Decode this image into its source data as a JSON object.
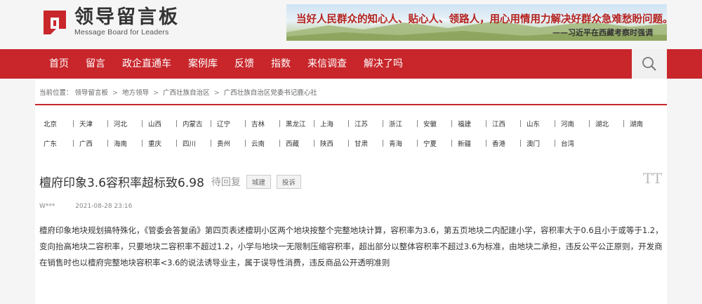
{
  "header": {
    "logo_cn": "领导留言板",
    "logo_en": "Message Board for Leaders",
    "banner_quote": "当好人民群众的知心人、贴心人、领路人，用心用情用力解决好群众急难愁盼问题。",
    "banner_author": "——习近平在西藏考察时强调"
  },
  "nav": {
    "items": [
      "首页",
      "留言",
      "政企直通车",
      "案例库",
      "反馈",
      "指数",
      "来信调查",
      "解决了吗"
    ],
    "search_icon": "search-icon"
  },
  "breadcrumb": {
    "prefix": "当前位置：",
    "items": [
      "领导留言板",
      "地方领导",
      "广西壮族自治区",
      "广西壮族自治区党委书记鹿心社"
    ],
    "separator": ">"
  },
  "regions": {
    "row1": [
      "北京",
      "天津",
      "河北",
      "山西",
      "内蒙古",
      "辽宁",
      "吉林",
      "黑龙江",
      "上海",
      "江苏",
      "浙江",
      "安徽",
      "福建",
      "江西",
      "山东",
      "河南",
      "湖北",
      "湖南"
    ],
    "row2": [
      "广东",
      "广西",
      "海南",
      "重庆",
      "四川",
      "贵州",
      "云南",
      "西藏",
      "陕西",
      "甘肃",
      "青海",
      "宁夏",
      "新疆",
      "香港",
      "澳门",
      "台湾"
    ]
  },
  "message": {
    "title": "檀府印象3.6容积率超标致6.98",
    "status": "待回复",
    "tag_type": "城建",
    "complain_label": "投诉",
    "font_toggle": "TT",
    "author": "W***",
    "time": "2021-08-28 23:16",
    "body": "檀府印象地块规划搞特殊化，《管委会答复函》第四页表述檀玥小区两个地块按整个完整地块计算，容积率为3.6，第五页地块二内配建小学，容积率大于0.6且小于或等于1.2，变向抬高地块二容积率，只要地块二容积率不超过1.2，小学与地块一无限制压缩容积率，超出部分以整体容积率不超过3.6为标准，由地块二承担，违反公平公正原则，开发商在销售时也以檀府完整地块容积率<3.6的说法诱导业主，属于误导性消费，违反商品公开透明准则"
  },
  "colors": {
    "brand_red": "#c8262b",
    "background": "#f5f5f5"
  }
}
